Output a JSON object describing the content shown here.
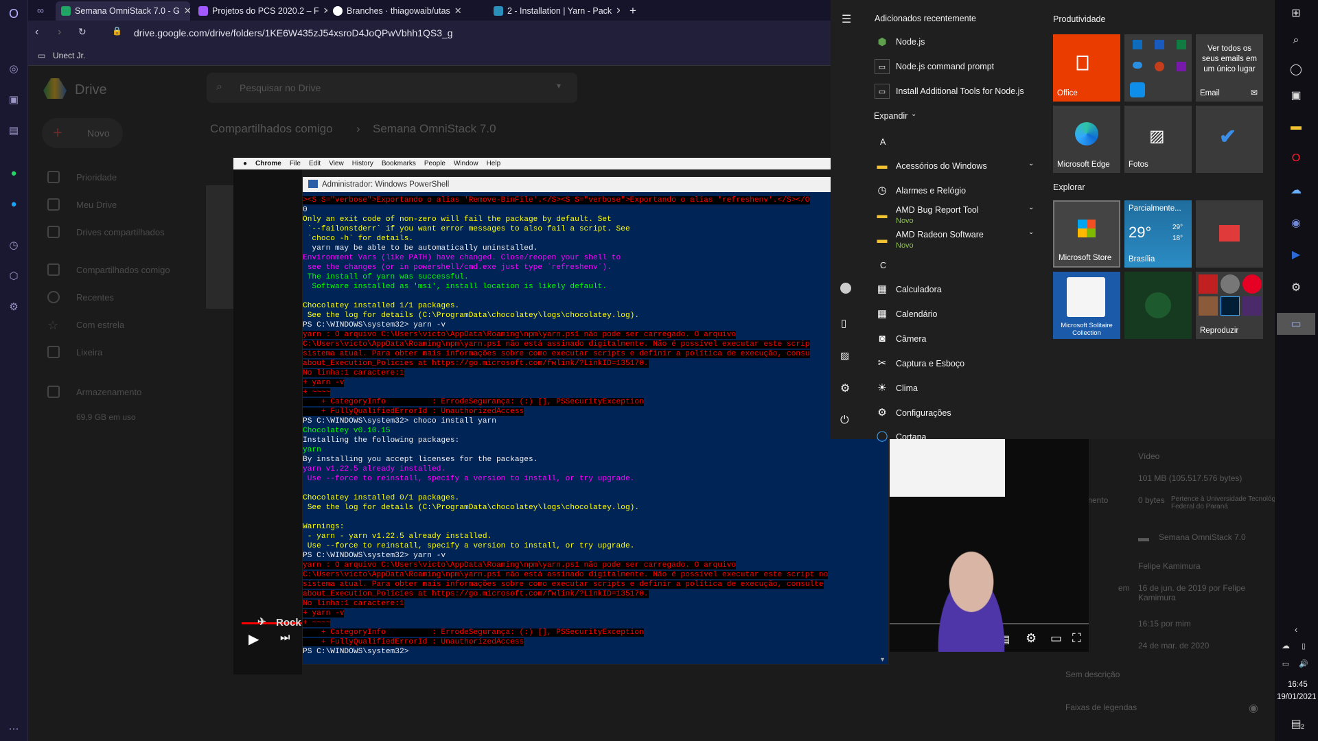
{
  "browser": {
    "tabs": [
      {
        "label": "Semana OmniStack 7.0 - G",
        "color": "#1fa463"
      },
      {
        "label": "Projetos do PCS 2020.2 – F",
        "color": "#a259ff"
      },
      {
        "label": "Branches · thiagowaib/utas",
        "color": "#ffffff"
      },
      {
        "label": "2 - Installation | Yarn - Pack",
        "color": "#2c8ebb"
      }
    ],
    "url": "drive.google.com/drive/folders/1KE6W435zJ54xsroD4JoQPwVbhh1QS3_g",
    "bookmark": "Unect Jr."
  },
  "drive": {
    "logo": "Drive",
    "search_placeholder": "Pesquisar no Drive",
    "breadcrumb_root": "Compartilhados comigo",
    "breadcrumb_folder": "Semana OmniStack 7.0",
    "new_label": "Novo",
    "sidebar": [
      "Prioridade",
      "Meu Drive",
      "Drives compartilhados",
      "Compartilhados comigo",
      "Recentes",
      "Com estrela",
      "Lixeira",
      "Armazenamento"
    ],
    "storage": "69,9 GB em uso",
    "details": {
      "type": "Vídeo",
      "size": "101 MB (105.517.576 bytes)",
      "used": "0 bytes",
      "owner_note": "Pertence à Universidade Tecnológica Federal do Paraná",
      "location": "Semana OmniStack 7.0",
      "owner": "Felipe Kamimura",
      "modified": "16 de jun. de 2019 por Felipe Kamimura",
      "modified_by_me": "16:15 por mim",
      "opened": "24 de mar. de 2020",
      "desc": "Sem descrição",
      "captions": "Faixas de legendas",
      "en_label": "em",
      "used_prefix": "mento"
    }
  },
  "mac_menu": [
    "Chrome",
    "File",
    "Edit",
    "View",
    "History",
    "Bookmarks",
    "People",
    "Window",
    "Help"
  ],
  "video": {
    "label": "Rock"
  },
  "powershell": {
    "title": "Administrador: Windows PowerShell",
    "lines": [
      {
        "c": "r",
        "t": "><S S=\"verbose\">Exportando o alias 'Remove-BinFile'.</S><S S=\"verbose\">Exportando o alias 'refreshenv'.</S></O"
      },
      {
        "c": "w",
        "t": "0"
      },
      {
        "c": "y",
        "t": "Only an exit code of non-zero will fail the package by default. Set"
      },
      {
        "c": "y",
        "t": " `--failonstderr` if you want error messages to also fail a script. See"
      },
      {
        "c": "y",
        "t": " `choco -h` for details."
      },
      {
        "c": "w",
        "t": "  yarn may be able to be automatically uninstalled."
      },
      {
        "c": "m",
        "t": "Environment Vars (like PATH) have changed. Close/reopen your shell to"
      },
      {
        "c": "m",
        "t": " see the changes (or in powershell/cmd.exe just type `refreshenv`)."
      },
      {
        "c": "g",
        "t": " The install of yarn was successful."
      },
      {
        "c": "g",
        "t": "  Software installed as 'msi', install location is likely default."
      },
      {
        "c": "w",
        "t": ""
      },
      {
        "c": "y",
        "t": "Chocolatey installed 1/1 packages."
      },
      {
        "c": "y",
        "t": " See the log for details (C:\\ProgramData\\chocolatey\\logs\\chocolatey.log)."
      },
      {
        "c": "w",
        "t": "PS C:\\WINDOWS\\system32> yarn -v"
      },
      {
        "c": "r",
        "t": "yarn : O arquivo C:\\Users\\victo\\AppData\\Roaming\\npm\\yarn.ps1 não pode ser carregado. O arquivo"
      },
      {
        "c": "r",
        "t": "C:\\Users\\victo\\AppData\\Roaming\\npm\\yarn.ps1 não está assinado digitalmente. Não é possível executar este scrip"
      },
      {
        "c": "r",
        "t": "sistema atual. Para obter mais informações sobre como executar scripts e definir a política de execução, consu"
      },
      {
        "c": "r",
        "t": "about_Execution_Policies at https://go.microsoft.com/fwlink/?LinkID=135170."
      },
      {
        "c": "r",
        "t": "No linha:1 caractere:1"
      },
      {
        "c": "r",
        "t": "+ yarn -v"
      },
      {
        "c": "r",
        "t": "+ ~~~~"
      },
      {
        "c": "r",
        "t": "    + CategoryInfo          : ErrodeSegurança: (:) [], PSSecurityException"
      },
      {
        "c": "r",
        "t": "    + FullyQualifiedErrorId : UnauthorizedAccess"
      },
      {
        "c": "w",
        "t": "PS C:\\WINDOWS\\system32> choco install yarn"
      },
      {
        "c": "g",
        "t": "Chocolatey v0.10.15"
      },
      {
        "c": "w",
        "t": "Installing the following packages:"
      },
      {
        "c": "g",
        "t": "yarn"
      },
      {
        "c": "w",
        "t": "By installing you accept licenses for the packages."
      },
      {
        "c": "m",
        "t": "yarn v1.22.5 already installed."
      },
      {
        "c": "m",
        "t": " Use --force to reinstall, specify a version to install, or try upgrade."
      },
      {
        "c": "w",
        "t": ""
      },
      {
        "c": "y",
        "t": "Chocolatey installed 0/1 packages."
      },
      {
        "c": "y",
        "t": " See the log for details (C:\\ProgramData\\chocolatey\\logs\\chocolatey.log)."
      },
      {
        "c": "w",
        "t": ""
      },
      {
        "c": "y",
        "t": "Warnings:"
      },
      {
        "c": "y",
        "t": " - yarn - yarn v1.22.5 already installed."
      },
      {
        "c": "y",
        "t": " Use --force to reinstall, specify a version to install, or try upgrade."
      },
      {
        "c": "w",
        "t": "PS C:\\WINDOWS\\system32> yarn -v"
      },
      {
        "c": "r",
        "t": "yarn : O arquivo C:\\Users\\victo\\AppData\\Roaming\\npm\\yarn.ps1 não pode ser carregado. O arquivo"
      },
      {
        "c": "r",
        "t": "C:\\Users\\victo\\AppData\\Roaming\\npm\\yarn.ps1 não está assinado digitalmente. Não é possível executar este script no"
      },
      {
        "c": "r",
        "t": "sistema atual. Para obter mais informações sobre como executar scripts e definir a política de execução, consulte"
      },
      {
        "c": "r",
        "t": "about_Execution_Policies at https://go.microsoft.com/fwlink/?LinkID=135170."
      },
      {
        "c": "r",
        "t": "No linha:1 caractere:1"
      },
      {
        "c": "r",
        "t": "+ yarn -v"
      },
      {
        "c": "r",
        "t": "+ ~~~~"
      },
      {
        "c": "r",
        "t": "    + CategoryInfo          : ErrodeSegurança: (:) [], PSSecurityException"
      },
      {
        "c": "r",
        "t": "    + FullyQualifiedErrorId : UnauthorizedAccess"
      },
      {
        "c": "w",
        "t": "PS C:\\WINDOWS\\system32>"
      }
    ]
  },
  "start": {
    "recent_header": "Adicionados recentemente",
    "recent": [
      "Node.js",
      "Node.js command prompt",
      "Install Additional Tools for Node.js"
    ],
    "expand": "Expandir",
    "letter_a": "A",
    "letter_c": "C",
    "apps": [
      {
        "label": "Acessórios do Windows",
        "sub": ""
      },
      {
        "label": "Alarmes e Relógio",
        "sub": ""
      },
      {
        "label": "AMD Bug Report Tool",
        "sub": "Novo"
      },
      {
        "label": "AMD Radeon Software",
        "sub": "Novo"
      },
      {
        "label": "Calculadora",
        "sub": ""
      },
      {
        "label": "Calendário",
        "sub": ""
      },
      {
        "label": "Câmera",
        "sub": ""
      },
      {
        "label": "Captura e Esboço",
        "sub": ""
      },
      {
        "label": "Clima",
        "sub": ""
      },
      {
        "label": "Configurações",
        "sub": ""
      },
      {
        "label": "Cortana",
        "sub": ""
      }
    ],
    "group1": "Produtividade",
    "group2": "Explorar",
    "tiles": {
      "office": "Office",
      "email_text": "Ver todos os seus emails em um único lugar",
      "email": "Email",
      "edge": "Microsoft Edge",
      "photos": "Fotos",
      "store": "Microsoft Store",
      "weather_title": "Parcialmente...",
      "weather_temp": "29°",
      "weather_hi": "29°",
      "weather_lo": "18°",
      "weather_city": "Brasília",
      "solitaire": "Microsoft Solitaire Collection",
      "play": "Reproduzir"
    }
  },
  "taskbar": {
    "time": "16:45",
    "date": "19/01/2021",
    "notif": "2"
  }
}
